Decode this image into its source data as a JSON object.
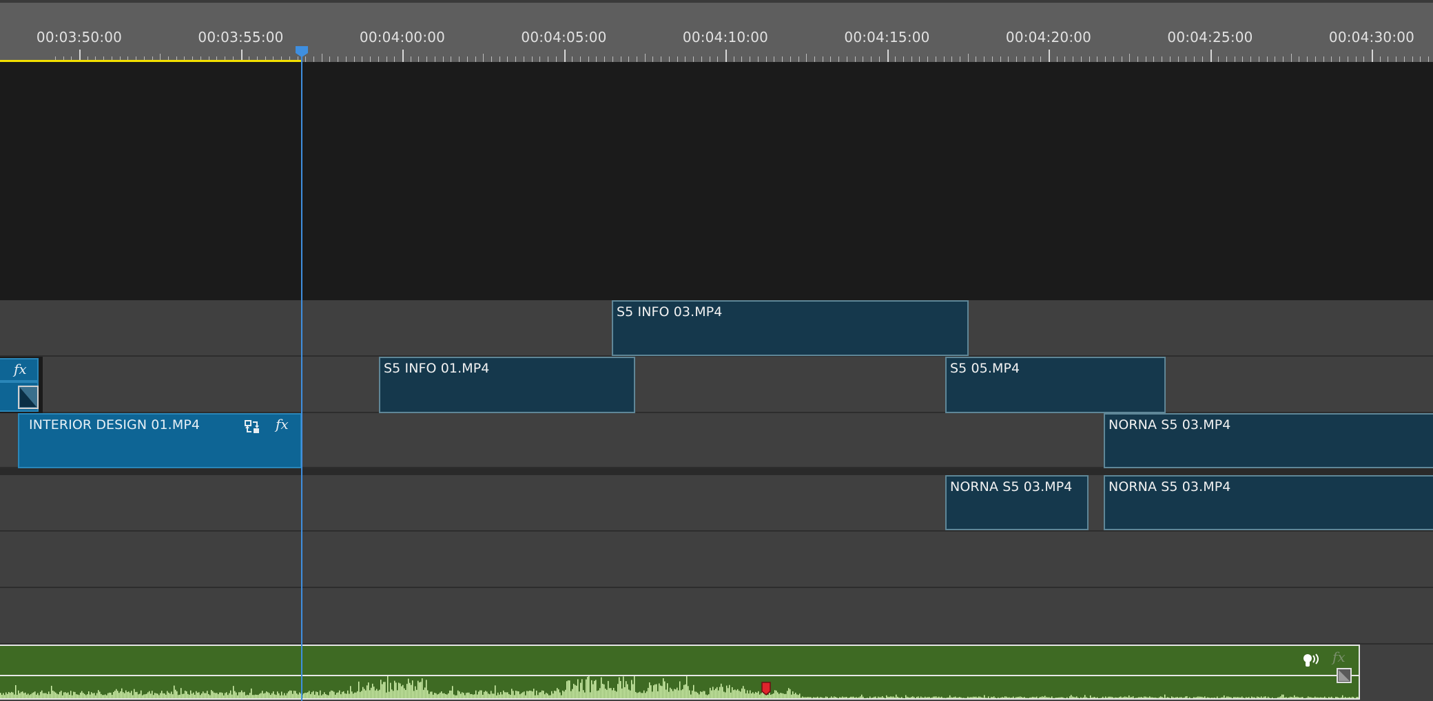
{
  "timeline": {
    "ruler_labels": [
      "00:03:50:00",
      "00:03:55:00",
      "00:04:00:00",
      "00:04:05:00",
      "00:04:10:00",
      "00:04:15:00",
      "00:04:20:00",
      "00:04:25:00",
      "00:04:30:00"
    ],
    "playhead_time": "00:03:56:15"
  },
  "clips": {
    "s5_info_03": "S5 INFO 03.MP4",
    "s5_info_01": "S5 INFO 01.MP4",
    "s5_05": "S5 05.MP4",
    "norna_v1": "NORNA S5 03.MP4",
    "interior_design": "INTERIOR DESIGN 01.MP4",
    "norna_a_left": "NORNA S5 03.MP4",
    "norna_a_right": "NORNA S5 03.MP4"
  },
  "icons": {
    "fx": "fx",
    "replace": "replace-clip-icon",
    "transition": "transition-icon",
    "voice": "voiceover-icon",
    "marker": "marker-icon"
  },
  "colors": {
    "clip_fill": "#15384c",
    "clip_selected": "#0e6595",
    "audio_fill": "#3e6a23",
    "playhead": "#3f8fe0",
    "work_area": "#f4e000",
    "marker": "#e0242c"
  }
}
